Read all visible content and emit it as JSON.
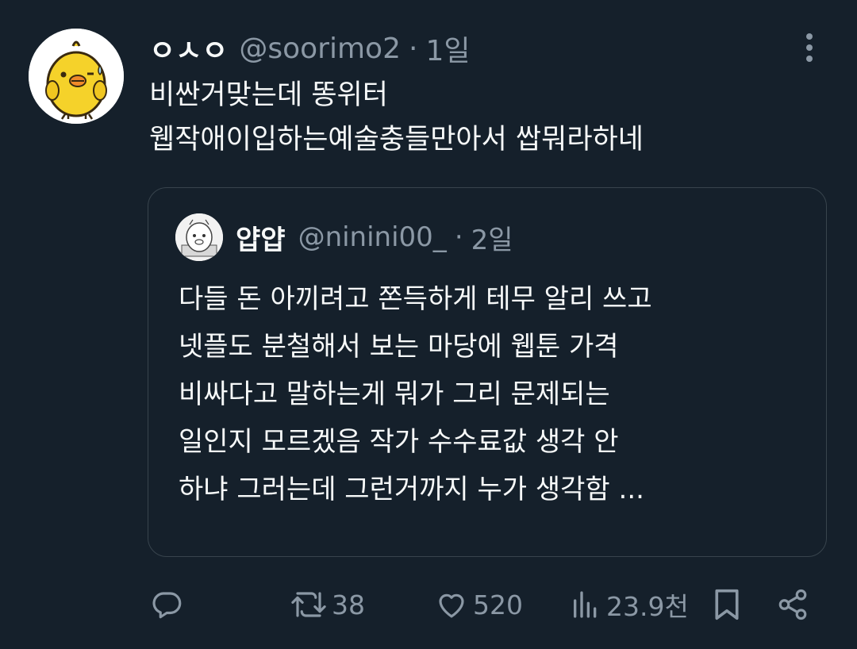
{
  "tweet": {
    "display_name": "ㅇㅅㅇ",
    "handle": "@soorimo2",
    "separator": "·",
    "time": "1일",
    "text_lines": [
      "비싼거맞는데 똥위터",
      "웹작애이입하는예술충들만아서 쌉뭐라하네"
    ]
  },
  "quote": {
    "display_name": "얍얍",
    "handle": "@ninini00_",
    "separator": "·",
    "time": "2일",
    "text_lines": [
      "다들 돈 아끼려고 쫀득하게 테무 알리 쓰고",
      "넷플도 분철해서 보는 마당에 웹툰 가격",
      "비싸다고 말하는게 뭐가 그리 문제되는",
      "일인지 모르겠음 작가 수수료값 생각 안",
      "하냐 그러는데 그런거까지 누가 생각함 ..."
    ]
  },
  "actions": {
    "reply": {
      "icon": "reply-icon",
      "count": ""
    },
    "retweet": {
      "icon": "retweet-icon",
      "count": "38"
    },
    "like": {
      "icon": "heart-icon",
      "count": "520"
    },
    "views": {
      "icon": "views-icon",
      "count": "23.9천"
    },
    "bookmark": {
      "icon": "bookmark-icon"
    },
    "share": {
      "icon": "share-icon"
    }
  },
  "colors": {
    "background": "#15202b",
    "text_primary": "#f7f9f9",
    "text_secondary": "#8b98a5",
    "border": "#38444d"
  }
}
